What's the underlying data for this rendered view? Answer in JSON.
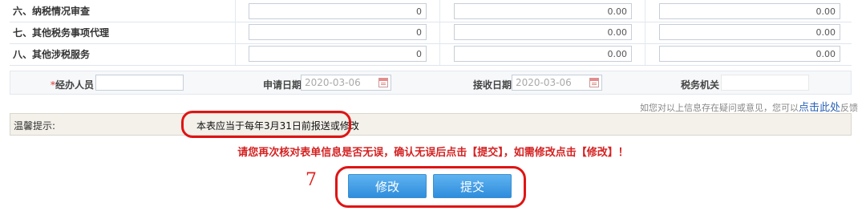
{
  "rows": [
    {
      "label": "六、纳税情况审查",
      "v1": "0",
      "v2": "0.00",
      "v3": "0.00"
    },
    {
      "label": "七、其他税务事项代理",
      "v1": "0",
      "v2": "0.00",
      "v3": "0.00"
    },
    {
      "label": "八、其他涉税服务",
      "v1": "0",
      "v2": "0.00",
      "v3": "0.00"
    }
  ],
  "info": {
    "required_mark": "*",
    "handler_label": "经办人员",
    "handler_value": "",
    "apply_date_label": "申请日期",
    "apply_date_value": "2020-03-06",
    "receive_date_label": "接收日期",
    "receive_date_value": "2020-03-06",
    "tax_office_label": "税务机关",
    "tax_office_value": ""
  },
  "feedback": {
    "text": "如您对以上信息存在疑问或意见，您可以",
    "link": "点击此处",
    "suffix": "反馈"
  },
  "tip": {
    "label": "温馨提示:",
    "text": "本表应当于每年3月31日前报送或修改"
  },
  "warning": "请您再次核对表单信息是否无误，确认无误后点击【提交】，如需修改点击【修改】！",
  "step_number": "7",
  "buttons": {
    "modify": "修改",
    "submit": "提交"
  },
  "colors": {
    "button": "#3a97e0",
    "highlight": "#e01414",
    "warning": "#d42222"
  }
}
